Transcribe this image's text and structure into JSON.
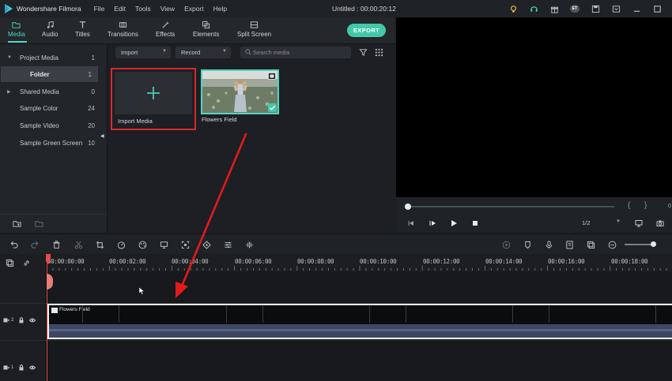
{
  "app": {
    "name": "Wondershare Filmora",
    "menu": [
      "File",
      "Edit",
      "Tools",
      "View",
      "Export",
      "Help"
    ],
    "project_title": "Untitled : 00:00:20:12"
  },
  "tabs": [
    {
      "label": "Media",
      "icon": "folder-icon",
      "active": true
    },
    {
      "label": "Audio",
      "icon": "music-note-icon"
    },
    {
      "label": "Titles",
      "icon": "text-t-icon"
    },
    {
      "label": "Transitions",
      "icon": "transition-icon"
    },
    {
      "label": "Effects",
      "icon": "effects-wand-icon"
    },
    {
      "label": "Elements",
      "icon": "elements-icon"
    },
    {
      "label": "Split Screen",
      "icon": "split-screen-icon"
    }
  ],
  "export_label": "EXPORT",
  "titlebar_badge": "ET",
  "sidebar": {
    "items": [
      {
        "label": "Project Media",
        "count": "1",
        "expander": "▼"
      },
      {
        "label": "Folder",
        "count": "1",
        "selected": true
      },
      {
        "label": "Shared Media",
        "count": "0",
        "expander": "▶"
      },
      {
        "label": "Sample Color",
        "count": "24"
      },
      {
        "label": "Sample Video",
        "count": "20"
      },
      {
        "label": "Sample Green Screen",
        "count": "10"
      }
    ]
  },
  "media_toolbar": {
    "import_dropdown": "Import",
    "record_dropdown": "Record",
    "search_placeholder": "Search media"
  },
  "media_items": {
    "import": "Import Media",
    "clip": "Flowers Field"
  },
  "preview": {
    "ratio": "1/2",
    "time_start": "0",
    "bracket_in": "{",
    "bracket_out": "}"
  },
  "timeline": {
    "ruler": [
      "00:00:00:00",
      "00:00:02:00",
      "00:00:04:00",
      "00:00:06:00",
      "00:00:08:00",
      "00:00:10:00",
      "00:00:12:00",
      "00:00:14:00",
      "00:00:16:00",
      "00:00:18:00"
    ],
    "clip_name": "Flowers Field",
    "tracks": [
      {
        "label": "2"
      },
      {
        "label": "1"
      }
    ]
  },
  "colors": {
    "accent": "#43c9a9",
    "highlight_border": "#d42a2a",
    "playhead": "#e24b4b"
  }
}
